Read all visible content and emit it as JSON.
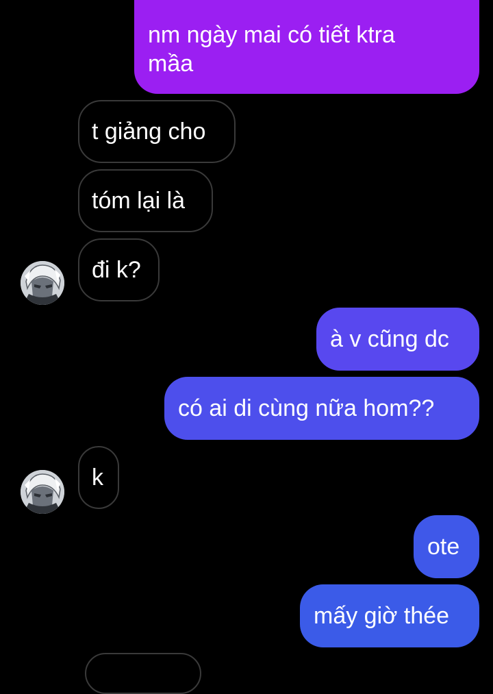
{
  "colors": {
    "background": "#000000",
    "outgoing_top": "#9b1ff2",
    "outgoing_mid": "#6f3ff0",
    "outgoing_bottom": "#3b5be8",
    "incoming_border": "#3a3a3a",
    "text": "#ffffff"
  },
  "contact": {
    "avatar_icon": "anime-character-avatar-icon"
  },
  "messages": [
    {
      "id": "m1",
      "direction": "outgoing",
      "lines": [
        "nm ngày mai có tiết ktra",
        "mầa"
      ]
    },
    {
      "id": "m2",
      "direction": "incoming",
      "text": "t giảng cho"
    },
    {
      "id": "m3",
      "direction": "incoming",
      "text": "tóm lại là"
    },
    {
      "id": "m4",
      "direction": "incoming",
      "text": "đi k?"
    },
    {
      "id": "m5",
      "direction": "outgoing",
      "text": "à v cũng dc"
    },
    {
      "id": "m6",
      "direction": "outgoing",
      "text": "có ai di cùng nữa hom??"
    },
    {
      "id": "m7",
      "direction": "incoming",
      "text": "k"
    },
    {
      "id": "m8",
      "direction": "outgoing",
      "text": "ote"
    },
    {
      "id": "m9",
      "direction": "outgoing",
      "text": "mấy giờ thée"
    }
  ]
}
